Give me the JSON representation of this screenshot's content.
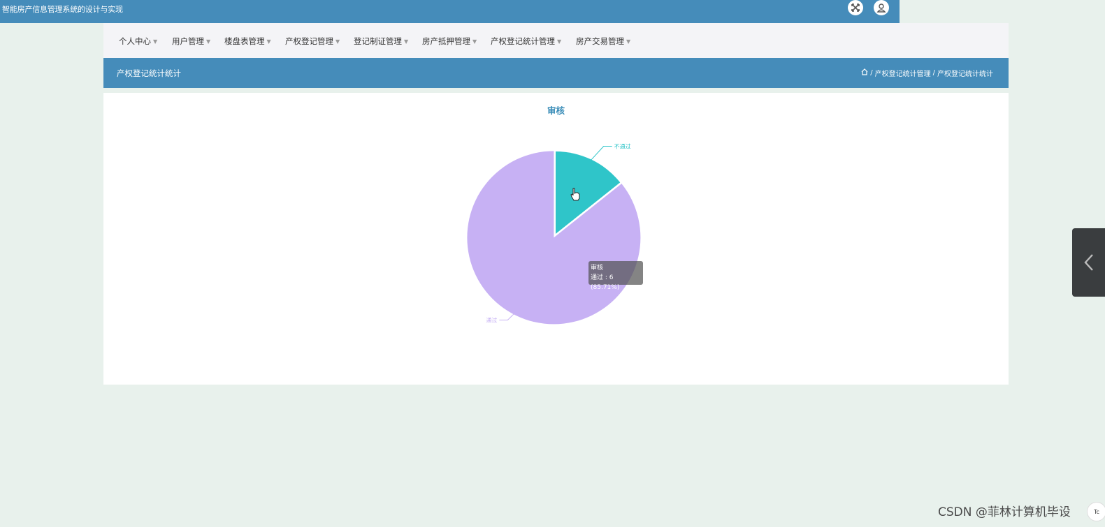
{
  "app": {
    "title": "智能房产信息管理系统的设计与实现"
  },
  "header_icons": {
    "fullscreen_icon": "expand-icon",
    "user_icon": "user-icon"
  },
  "nav": {
    "items": [
      {
        "label": "个人中心"
      },
      {
        "label": "用户管理"
      },
      {
        "label": "楼盘表管理"
      },
      {
        "label": "产权登记管理"
      },
      {
        "label": "登记制证管理"
      },
      {
        "label": "房产抵押管理"
      },
      {
        "label": "产权登记统计管理"
      },
      {
        "label": "房产交易管理"
      }
    ]
  },
  "page": {
    "title": "产权登记统计统计",
    "breadcrumb": {
      "home_icon": "home-icon",
      "items": [
        "产权登记统计管理",
        "产权登记统计统计"
      ],
      "sep": "/"
    }
  },
  "chart_data": {
    "type": "pie",
    "title": "审核",
    "slices": [
      {
        "name": "通过",
        "value": 6,
        "percent": 85.71,
        "color": "#c7b1f4"
      },
      {
        "name": "不通过",
        "value": 1,
        "percent": 14.29,
        "color": "#2fc5c9"
      }
    ]
  },
  "tooltip": {
    "title": "审核",
    "text": "通过 : 6 (85.71%)"
  },
  "watermark": {
    "text": "CSDN @菲林计算机毕设",
    "badge": "Tc"
  }
}
